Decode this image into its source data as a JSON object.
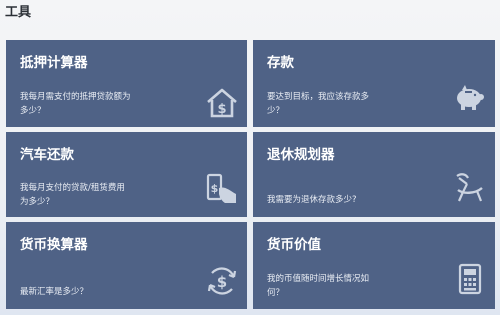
{
  "page": {
    "title": "工具"
  },
  "cards": [
    {
      "title": "抵押计算器",
      "desc_line1": "我每月需支付的抵押贷款额为",
      "desc_line2": "多少？",
      "icon": "house-dollar-icon"
    },
    {
      "title": "存款",
      "desc_line1": "要达到目标，我应该存款多",
      "desc_line2": "少？",
      "icon": "piggy-bank-icon"
    },
    {
      "title": "汽车还款",
      "desc_line1": "我每月支付的贷款/租赁费用",
      "desc_line2": "为多少？",
      "icon": "hand-cash-icon"
    },
    {
      "title": "退休规划器",
      "desc_line1": "我需要为退休存款多少?",
      "desc_line2": "",
      "icon": "beach-chair-icon"
    },
    {
      "title": "货币换算器",
      "desc_line1": "最新汇率是多少？",
      "desc_line2": "",
      "icon": "currency-exchange-icon"
    },
    {
      "title": "货币价值",
      "desc_line1": "我的币值随时间增长情况如",
      "desc_line2": "何？",
      "icon": "calculator-icon"
    }
  ],
  "colors": {
    "card_bg": "#4f6286",
    "icon_fg": "#d7dee9",
    "page_bg": "#f4f5f7"
  }
}
